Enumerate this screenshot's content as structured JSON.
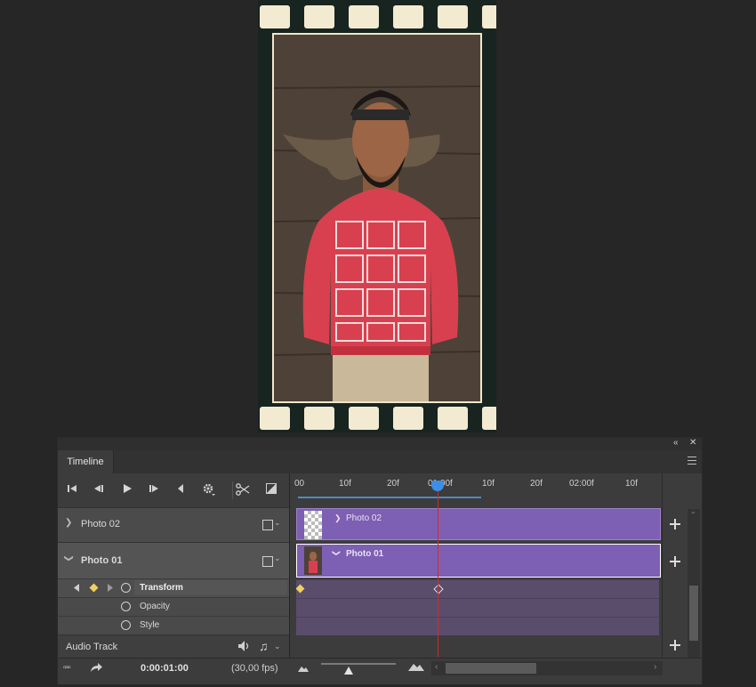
{
  "panel": {
    "tab_label": "Timeline"
  },
  "ruler": {
    "ticks": [
      "00",
      "10f",
      "20f",
      "01:00f",
      "10f",
      "20f",
      "02:00f",
      "10f"
    ]
  },
  "tracks": [
    {
      "name": "Photo 02",
      "clip_label": "Photo 02",
      "expanded": false
    },
    {
      "name": "Photo 01",
      "clip_label": "Photo 01",
      "expanded": true
    }
  ],
  "properties": [
    {
      "name": "Transform",
      "keyframes": true
    },
    {
      "name": "Opacity",
      "keyframes": false
    },
    {
      "name": "Style",
      "keyframes": false
    }
  ],
  "audio": {
    "label": "Audio Track"
  },
  "status": {
    "current_time": "0:00:01:00",
    "fps": "(30,00 fps)"
  },
  "colors": {
    "clip": "#7d5fb3",
    "playhead": "#d22b2b",
    "playhead_head": "#3d8ee6",
    "keyframe": "#f0d060",
    "film_bg": "#182420",
    "film_hole": "#f3ead2"
  },
  "icons": [
    "go-to-first-frame-icon",
    "previous-frame-icon",
    "play-icon",
    "next-frame-icon",
    "mute-audio-icon",
    "settings-icon",
    "split-scissors-icon",
    "transition-icon",
    "film-icon",
    "stopwatch-icon",
    "keyframe-nav-icon",
    "volume-icon",
    "music-note-icon",
    "convert-frames-icon",
    "render-icon",
    "zoom-out-icon",
    "zoom-in-icon"
  ]
}
